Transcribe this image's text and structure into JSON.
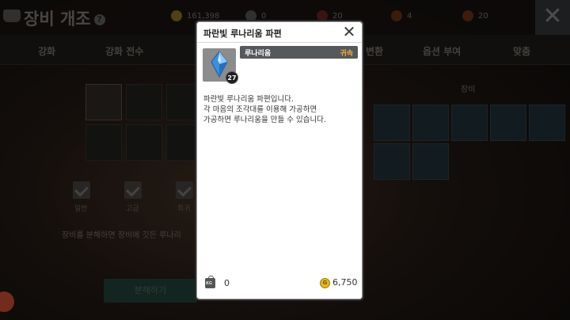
{
  "background": {
    "title": "장비 개조",
    "help_mark": "?",
    "resources": [
      {
        "icon": "gold-coin-icon",
        "value": "161,398",
        "color": "#c9a227"
      },
      {
        "icon": "stone-icon",
        "value": "0",
        "color": "#777777"
      },
      {
        "icon": "heart-icon",
        "value": "20",
        "color": "#9b2a2a"
      },
      {
        "icon": "shield-badge-icon",
        "value": "4",
        "color": "#b34c1e"
      },
      {
        "icon": "potion-icon",
        "value": "20",
        "color": "#c8502a"
      }
    ],
    "close_glyph": "✕",
    "tabs": [
      "강화",
      "강화 전수",
      "변환",
      "옵션 부여",
      "맞춤"
    ],
    "filters": [
      "일반",
      "고급",
      "희귀"
    ],
    "description": "장비를 분해하면 장비에 깃든 루나리",
    "button_label": "분해하기",
    "equip_label": "장비"
  },
  "modal": {
    "title": "파란빛 루나리움 파편",
    "close_glyph": "✕",
    "item": {
      "icon": "blue-crystal-icon",
      "count": "27",
      "category": "루나리움",
      "bind": "귀속",
      "bind_color": "#f0b42a"
    },
    "description": [
      "파란빛 루나리움 파편입니다.",
      "각 마음의 조각대를 이용해 가공하면",
      "가공하면 루나리움을 만들 수 있습니다."
    ],
    "weight": "0",
    "price": "6,750"
  }
}
